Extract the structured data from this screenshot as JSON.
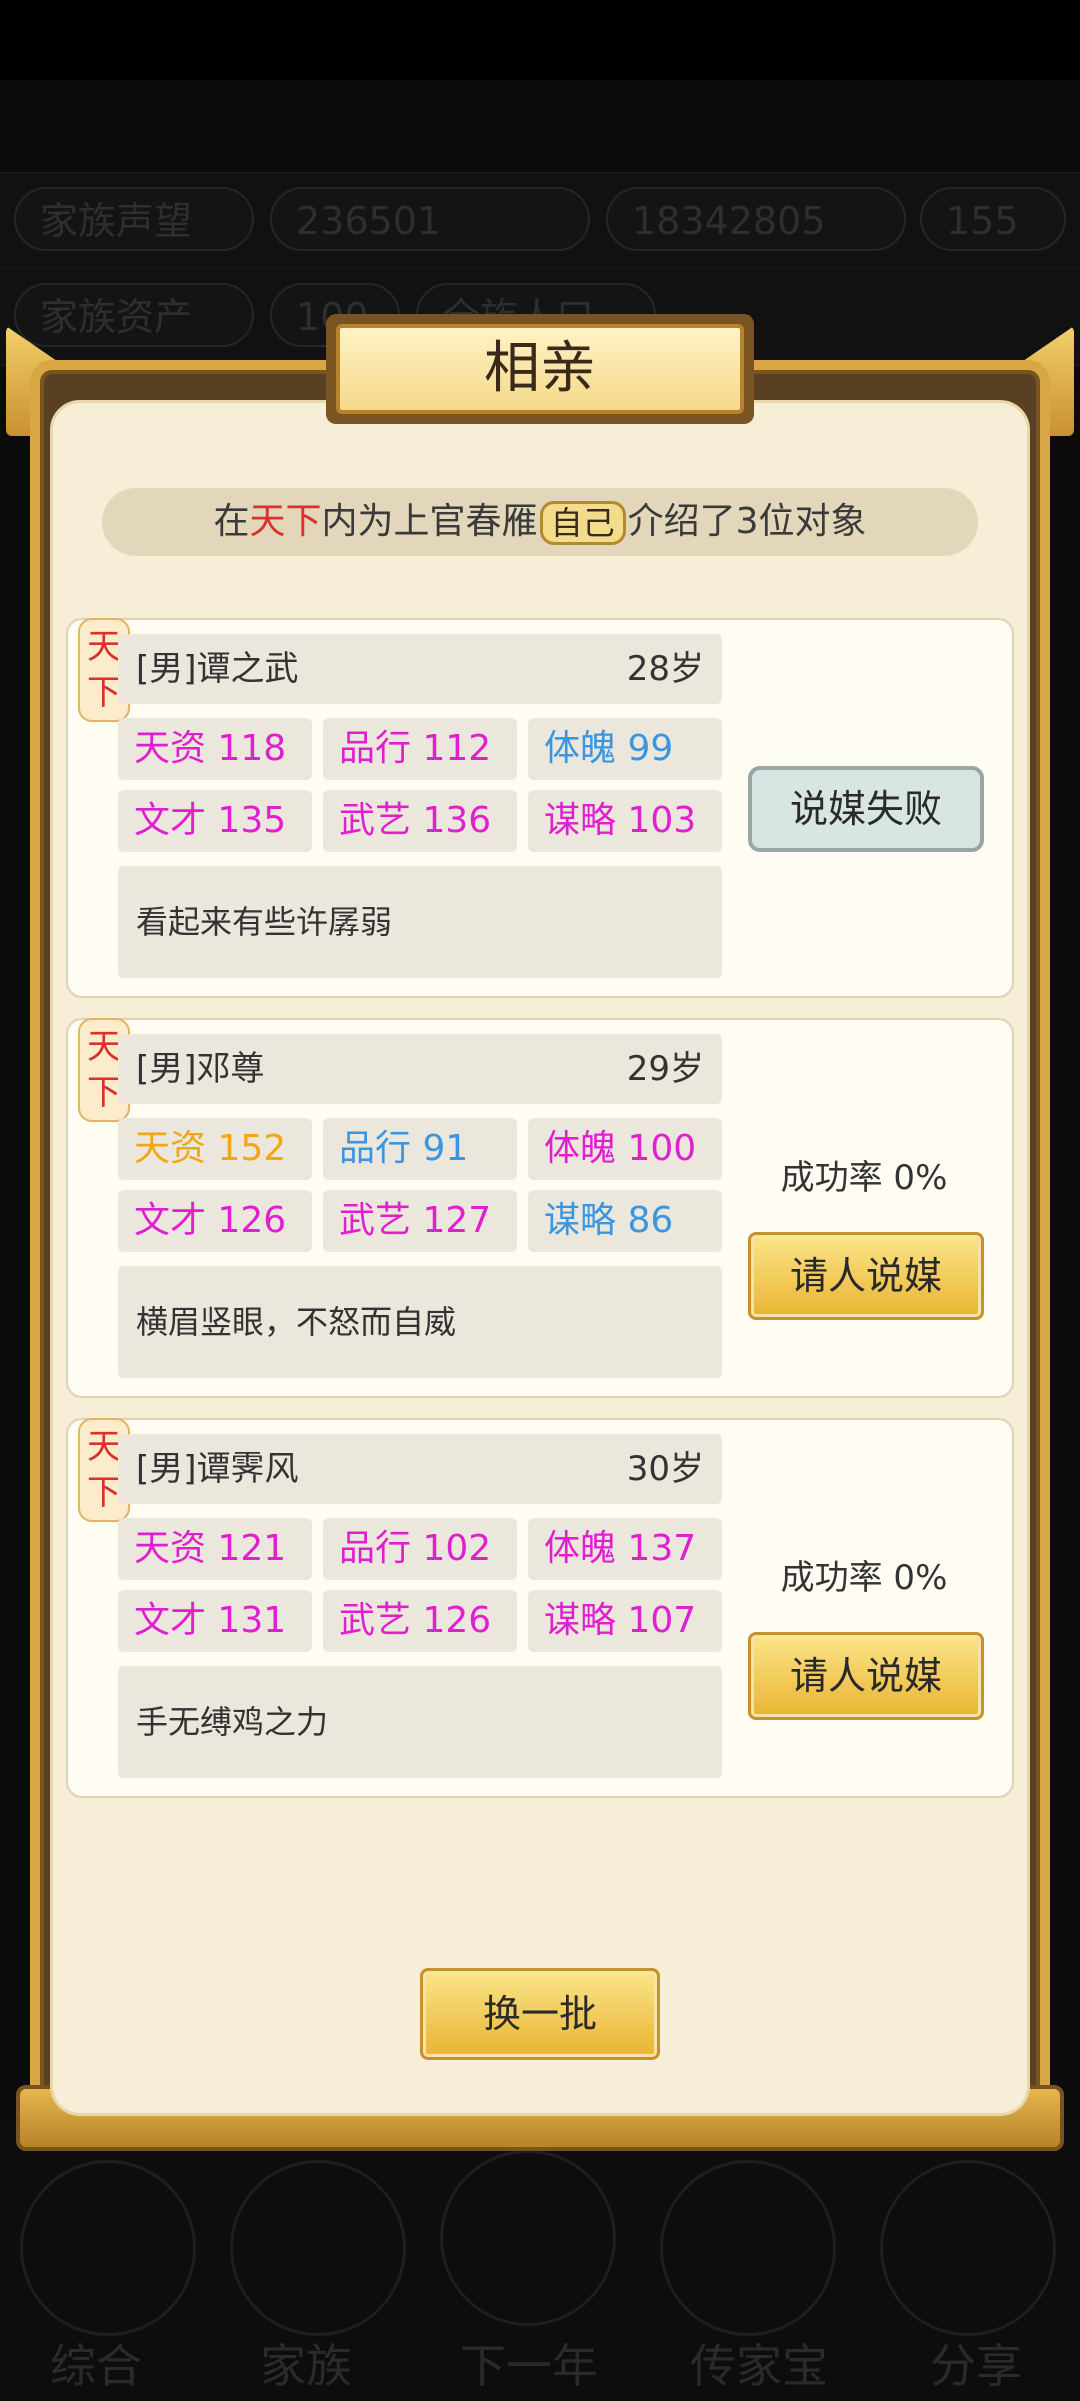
{
  "dialog": {
    "title": "相亲",
    "intro_prefix": "在",
    "intro_region": "天下",
    "intro_middle": "内为上官春雁",
    "intro_self": "自己",
    "intro_suffix": "介绍了3位对象",
    "refresh_label": "换一批"
  },
  "candidates": [
    {
      "tag_top": "天",
      "tag_bottom": "下",
      "name": "[男]谭之武",
      "age": "28岁",
      "stats": [
        {
          "label": "天资 118",
          "color": "#e020d0"
        },
        {
          "label": "品行 112",
          "color": "#e020d0"
        },
        {
          "label": "体魄 99",
          "color": "#3a96e0"
        },
        {
          "label": "文才 135",
          "color": "#e020d0"
        },
        {
          "label": "武艺 136",
          "color": "#e020d0"
        },
        {
          "label": "谋略 103",
          "color": "#e020d0"
        }
      ],
      "description": "看起来有些许孱弱",
      "action_label": "说媒失败"
    },
    {
      "tag_top": "天",
      "tag_bottom": "下",
      "name": "[男]邓尊",
      "age": "29岁",
      "stats": [
        {
          "label": "天资 152",
          "color": "#f2a614"
        },
        {
          "label": "品行 91",
          "color": "#3a96e0"
        },
        {
          "label": "体魄 100",
          "color": "#e020d0"
        },
        {
          "label": "文才 126",
          "color": "#e020d0"
        },
        {
          "label": "武艺 127",
          "color": "#e020d0"
        },
        {
          "label": "谋略 86",
          "color": "#3a96e0"
        }
      ],
      "description": "横眉竖眼，不怒而自威",
      "success_rate": "成功率 0%",
      "action_label": "请人说媒"
    },
    {
      "tag_top": "天",
      "tag_bottom": "下",
      "name": "[男]谭霁风",
      "age": "30岁",
      "stats": [
        {
          "label": "天资 121",
          "color": "#e020d0"
        },
        {
          "label": "品行 102",
          "color": "#e020d0"
        },
        {
          "label": "体魄 137",
          "color": "#e020d0"
        },
        {
          "label": "文才 131",
          "color": "#e020d0"
        },
        {
          "label": "武艺 126",
          "color": "#e020d0"
        },
        {
          "label": "谋略 107",
          "color": "#e020d0"
        }
      ],
      "description": "手无缚鸡之力",
      "success_rate": "成功率 0%",
      "action_label": "请人说媒"
    }
  ],
  "background": {
    "row1": [
      "家族声望",
      "236501",
      "18342805",
      "155"
    ],
    "row2": [
      "家族资产",
      "100",
      "全族人口"
    ],
    "nav": [
      "综合",
      "家族",
      "下一年",
      "传家宝",
      "分享"
    ]
  }
}
